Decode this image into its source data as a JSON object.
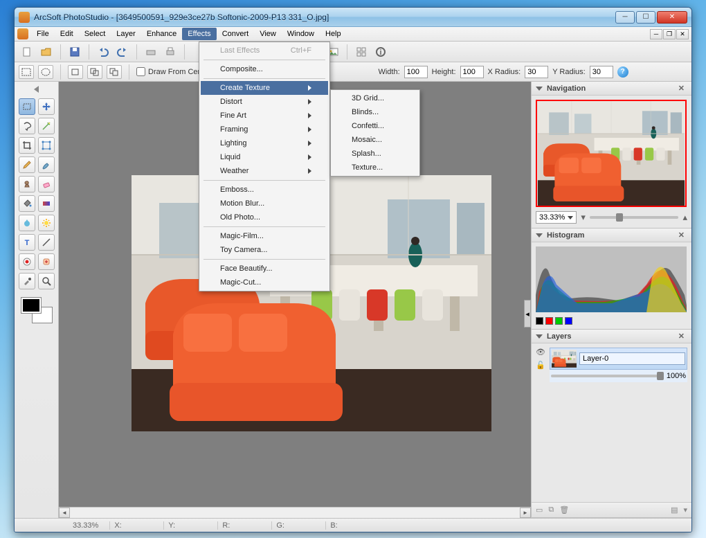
{
  "window": {
    "title": "ArcSoft PhotoStudio - [3649500591_929e3ce27b Softonic-2009-P13 331_O.jpg]"
  },
  "menu": {
    "items": [
      "File",
      "Edit",
      "Select",
      "Layer",
      "Enhance",
      "Effects",
      "Convert",
      "View",
      "Window",
      "Help"
    ],
    "open_index": 5
  },
  "effects_menu": {
    "items": [
      {
        "label": "Last Effects",
        "shortcut": "Ctrl+F",
        "disabled": true
      },
      {
        "sep": true
      },
      {
        "label": "Composite..."
      },
      {
        "sep": true
      },
      {
        "label": "Create Texture",
        "submenu": true,
        "hover": true
      },
      {
        "label": "Distort",
        "submenu": true
      },
      {
        "label": "Fine Art",
        "submenu": true
      },
      {
        "label": "Framing",
        "submenu": true
      },
      {
        "label": "Lighting",
        "submenu": true
      },
      {
        "label": "Liquid",
        "submenu": true
      },
      {
        "label": "Weather",
        "submenu": true
      },
      {
        "sep": true
      },
      {
        "label": "Emboss..."
      },
      {
        "label": "Motion Blur..."
      },
      {
        "label": "Old Photo..."
      },
      {
        "sep": true
      },
      {
        "label": "Magic-Film..."
      },
      {
        "label": "Toy Camera..."
      },
      {
        "sep": true
      },
      {
        "label": "Face Beautify..."
      },
      {
        "label": "Magic-Cut..."
      }
    ]
  },
  "texture_submenu": {
    "items": [
      "3D Grid...",
      "Blinds...",
      "Confetti...",
      "Mosaic...",
      "Splash...",
      "Texture..."
    ]
  },
  "options": {
    "draw_from_center_label": "Draw From Center",
    "width_label": "Width:",
    "width_value": "100",
    "height_label": "Height:",
    "height_value": "100",
    "xradius_label": "X Radius:",
    "xradius_value": "30",
    "yradius_label": "Y Radius:",
    "yradius_value": "30"
  },
  "panels": {
    "navigation": {
      "title": "Navigation",
      "zoom": "33.33%"
    },
    "histogram": {
      "title": "Histogram",
      "swatches": [
        "#000",
        "#f00",
        "#0c0",
        "#00f"
      ]
    },
    "layers": {
      "title": "Layers",
      "name": "Layer-0",
      "opacity": "100%"
    }
  },
  "status": {
    "zoom": "33.33%",
    "labels": [
      "X:",
      "Y:",
      "R:",
      "G:",
      "B:"
    ]
  },
  "tooltips": {
    "help": "?"
  }
}
